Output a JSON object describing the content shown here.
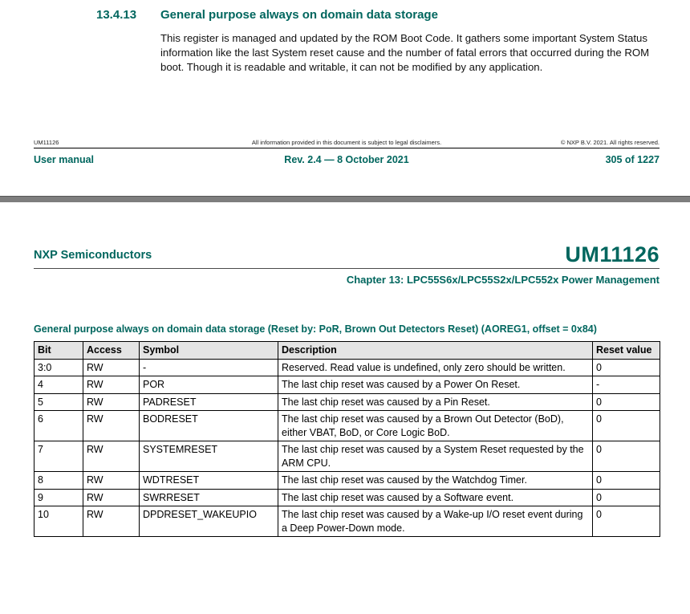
{
  "colors": {
    "accent_teal": "#00665E",
    "table_header_bg": "#E4E4E4",
    "separator_gray": "#7E7E7E"
  },
  "page_top": {
    "section_number": "13.4.13",
    "section_title": "General purpose always on domain data storage",
    "paragraph": "This register is managed and updated by the ROM Boot Code. It gathers some important System Status information like the last System reset cause and the number of fatal errors that occurred during the ROM boot. Though it is readable and writable, it can not be modified by any application.",
    "footer": {
      "doc_id": "UM11126",
      "disclaimer": "All information provided in this document is subject to legal disclaimers.",
      "copyright": "© NXP B.V. 2021. All rights reserved.",
      "manual_label": "User manual",
      "revision": "Rev. 2.4 — 8 October 2021",
      "page_indicator": "305 of 1227"
    }
  },
  "page_bottom": {
    "header": {
      "company": "NXP Semiconductors",
      "doc_id": "UM11126",
      "chapter": "Chapter 13: LPC55S6x/LPC55S2x/LPC552x Power Management"
    },
    "table_caption": "General purpose always on domain data storage (Reset by: PoR, Brown Out Detectors Reset) (AOREG1, offset = 0x84)",
    "table": {
      "headers": [
        "Bit",
        "Access",
        "Symbol",
        "Description",
        "Reset value"
      ],
      "rows": [
        [
          "3:0",
          "RW",
          "-",
          "Reserved. Read value is undefined, only zero should be written.",
          "0"
        ],
        [
          "4",
          "RW",
          "POR",
          "The last chip reset was caused by a Power On Reset.",
          "-"
        ],
        [
          "5",
          "RW",
          "PADRESET",
          "The last chip reset was caused by a Pin Reset.",
          "0"
        ],
        [
          "6",
          "RW",
          "BODRESET",
          "The last chip reset was caused by a Brown Out Detector (BoD), either VBAT, BoD, or Core Logic BoD.",
          "0"
        ],
        [
          "7",
          "RW",
          "SYSTEMRESET",
          "The last chip reset was caused by a System Reset requested by the ARM CPU.",
          "0"
        ],
        [
          "8",
          "RW",
          "WDTRESET",
          "The last chip reset was caused by the Watchdog Timer.",
          "0"
        ],
        [
          "9",
          "RW",
          "SWRRESET",
          "The last chip reset was caused by a Software event.",
          "0"
        ],
        [
          "10",
          "RW",
          "DPDRESET_WAKEUPIO",
          "The last chip reset was caused by a Wake-up I/O reset event during a Deep Power-Down mode.",
          "0"
        ]
      ]
    }
  }
}
